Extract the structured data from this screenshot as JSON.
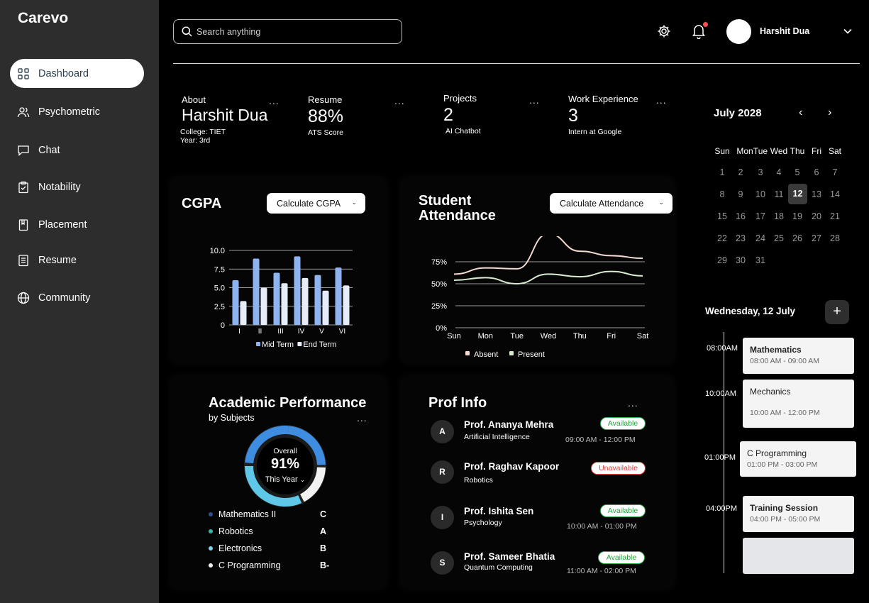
{
  "app": {
    "logo": "Carevo"
  },
  "sidebar": {
    "items": [
      {
        "label": "Dashboard",
        "icon": "grid-icon",
        "active": true
      },
      {
        "label": "Psychometric",
        "icon": "users-icon"
      },
      {
        "label": "Chat",
        "icon": "chat-icon"
      },
      {
        "label": "Notability",
        "icon": "clipboard-icon"
      },
      {
        "label": "Placement",
        "icon": "bookmark-icon"
      },
      {
        "label": "Resume",
        "icon": "document-icon"
      },
      {
        "label": "Community",
        "icon": "globe-icon"
      }
    ]
  },
  "header": {
    "search_placeholder": "Search anything",
    "user_name": "Harshit Dua",
    "notification_dot_color": "#ff4d4d"
  },
  "stats": {
    "about": {
      "label": "About",
      "name": "Harshit Dua",
      "college": "College: TIET",
      "year": "Year: 3rd",
      "more": "..."
    },
    "resume": {
      "label": "Resume",
      "value": "88%",
      "sub": "ATS Score",
      "more": "..."
    },
    "projects": {
      "label": "Projects",
      "value": "2",
      "sub": "AI Chatbot",
      "more": "..."
    },
    "work": {
      "label": "Work Experience",
      "value": "3",
      "sub": "Intern at Google",
      "more": "..."
    }
  },
  "cgpa": {
    "title": "CGPA",
    "button": "Calculate CGPA"
  },
  "attendance": {
    "title": "Student Attendance",
    "button": "Calculate Attendance"
  },
  "chart_data": [
    {
      "type": "bar",
      "categories": [
        "I",
        "II",
        "III",
        "IV",
        "V",
        "VI"
      ],
      "series": [
        {
          "name": "Mid Term",
          "values": [
            6.0,
            8.9,
            7.0,
            9.2,
            6.7,
            7.7
          ],
          "color": "#8db4ee"
        },
        {
          "name": "End Term",
          "values": [
            3.2,
            5.0,
            5.6,
            6.3,
            4.6,
            5.3
          ],
          "color": "#e6edf9"
        }
      ],
      "ylim": [
        0,
        10
      ],
      "yticks": [
        "0",
        "2.5",
        "5.0",
        "7.5",
        "10.0"
      ],
      "grid": true,
      "legend": "bottom"
    },
    {
      "type": "line",
      "categories": [
        "Sun",
        "Mon",
        "Tue",
        "Wed",
        "Thu",
        "Fri",
        "Sat"
      ],
      "series": [
        {
          "name": "Absent",
          "values": [
            61,
            68,
            67,
            107,
            87,
            82,
            79
          ],
          "color": "#f3d9cf"
        },
        {
          "name": "Present",
          "values": [
            54,
            57,
            50,
            61,
            58,
            64,
            59
          ],
          "color": "#d9ebcf"
        }
      ],
      "ylim": [
        0,
        100
      ],
      "yticks": [
        "0%",
        "25%",
        "50%",
        "75%"
      ],
      "grid": true,
      "legend": "bottom"
    }
  ],
  "academic": {
    "title": "Academic Performance",
    "subtitle": "by Subjects",
    "more": "...",
    "overall_label": "Overall",
    "overall_value": "91%",
    "period": "This Year",
    "overall_fraction": 0.91,
    "subjects": [
      {
        "name": "Mathematics II",
        "grade": "C",
        "color": "#2f4f8a"
      },
      {
        "name": "Robotics",
        "grade": "A",
        "color": "#3bb3a6"
      },
      {
        "name": "Electronics",
        "grade": "B",
        "color": "#7fd1ea"
      },
      {
        "name": "C Programming",
        "grade": "B-",
        "color": "#f2f2f2"
      }
    ]
  },
  "profs": {
    "title": "Prof Info",
    "more": "...",
    "list": [
      {
        "initial": "A",
        "name": "Prof. Ananya Mehra",
        "dept": "Artificial Intelligence",
        "status": "Available",
        "time": "09:00 AM - 12:00 PM"
      },
      {
        "initial": "R",
        "name": "Prof. Raghav Kapoor",
        "dept": "Robotics",
        "status": "Unavailable",
        "time": ""
      },
      {
        "initial": "I",
        "name": "Prof. Ishita Sen",
        "dept": "Psychology",
        "status": "Available",
        "time": "10:00 AM - 01:00 PM"
      },
      {
        "initial": "S",
        "name": "Prof. Sameer Bhatia",
        "dept": "Quantum Computing",
        "status": "Available",
        "time": "11:00 AM - 02:00 PM"
      }
    ]
  },
  "calendar": {
    "month": "July 2028",
    "weekdays": [
      "Sun",
      "Mon",
      "Tue",
      "Wed",
      "Thu",
      "Fri",
      "Sat"
    ],
    "days": [
      "1",
      "2",
      "3",
      "4",
      "5",
      "6",
      "7",
      "8",
      "9",
      "10",
      "11",
      "12",
      "13",
      "14",
      "15",
      "16",
      "17",
      "18",
      "19",
      "20",
      "21",
      "22",
      "23",
      "24",
      "25",
      "26",
      "27",
      "28",
      "29",
      "30",
      "31"
    ],
    "today": "12"
  },
  "schedule": {
    "date": "Wednesday, 12 July",
    "add": "+",
    "times": [
      "08:00AM",
      "10:00AM",
      "01:00PM",
      "04:00PM"
    ],
    "events": [
      {
        "name": "Mathematics",
        "time": "08:00 AM - 09:00 AM"
      },
      {
        "name": "Mechanics",
        "time": "10:00 AM - 12:00 PM"
      },
      {
        "name": "C Programming",
        "time": "01:00 PM - 03:00 PM"
      },
      {
        "name": "Training Session",
        "time": "04:00 PM - 05:00 PM"
      }
    ]
  }
}
